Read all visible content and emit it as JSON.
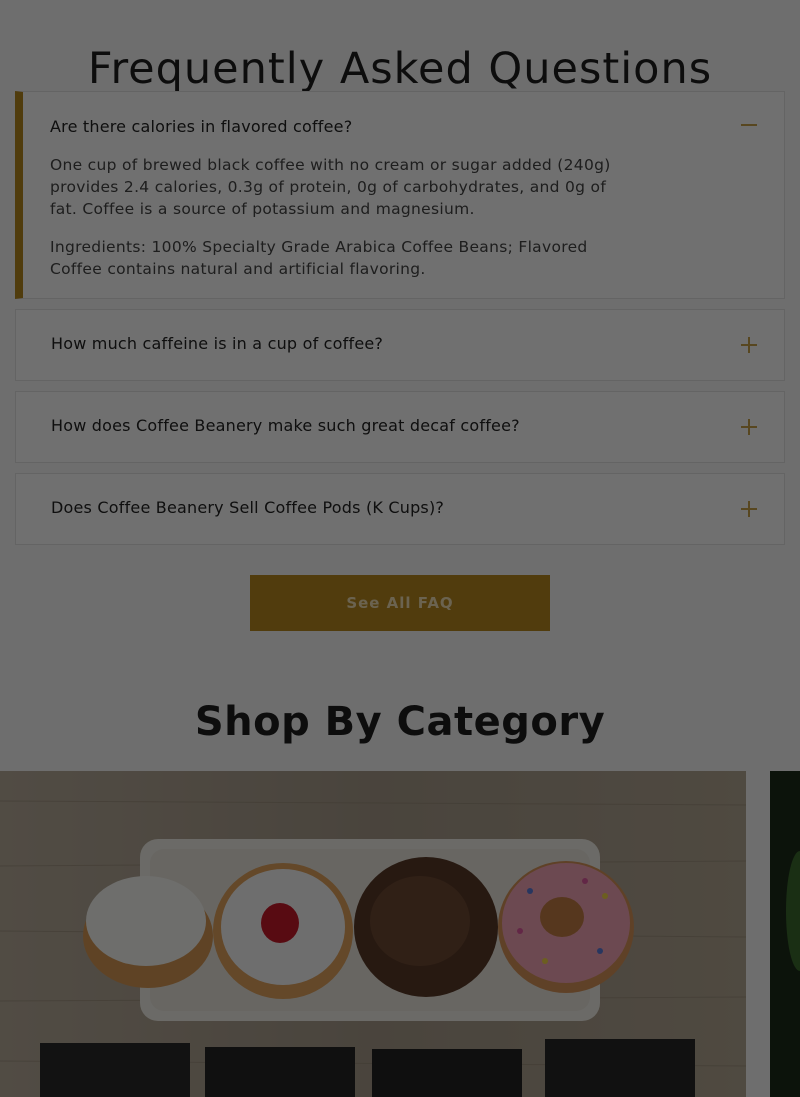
{
  "faq": {
    "title": "Frequently Asked Questions",
    "items": [
      {
        "question": "Are there calories in flavored coffee?",
        "expanded": true,
        "answer": [
          "One cup of brewed black coffee with no cream or sugar added (240g) provides 2.4 calories, 0.3g of protein, 0g of carbohydrates, and 0g of fat. Coffee is a source of potassium and magnesium.",
          "Ingredients: 100% Specialty Grade Arabica Coffee Beans; Flavored Coffee contains natural and artificial flavoring."
        ]
      },
      {
        "question": "How much caffeine is in a cup of coffee?",
        "expanded": false
      },
      {
        "question": "How does Coffee Beanery make such great decaf coffee?",
        "expanded": false
      },
      {
        "question": "Does Coffee Beanery Sell Coffee Pods (K Cups)?",
        "expanded": false
      }
    ],
    "see_all_label": "See All FAQ"
  },
  "categories": {
    "title": "Shop By Category"
  },
  "colors": {
    "accent": "#b8891f",
    "overlay": "rgba(0,0,0,0.56)"
  }
}
